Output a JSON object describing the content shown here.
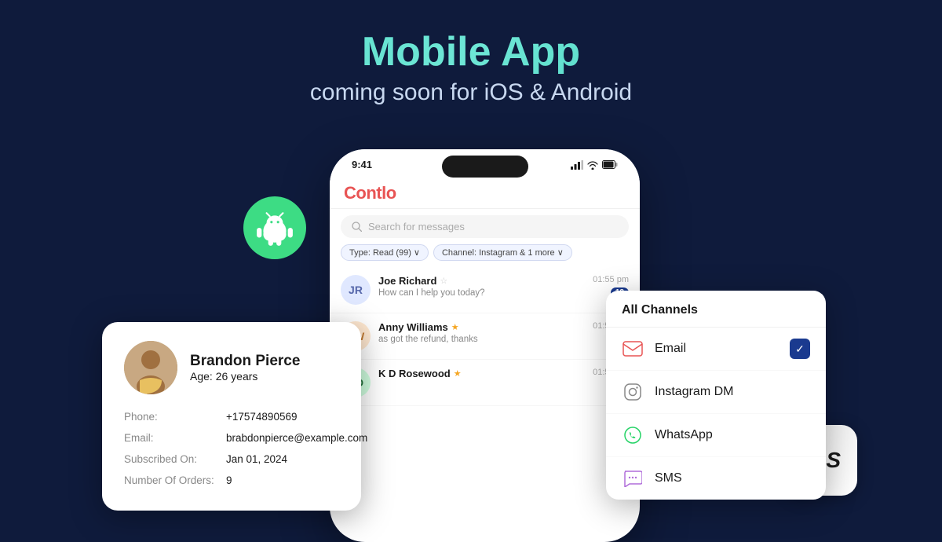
{
  "header": {
    "title": "Mobile App",
    "subtitle": "coming soon for iOS & Android"
  },
  "phone": {
    "time": "9:41",
    "app_name": "Contlo",
    "search_placeholder": "Search for messages",
    "filter_chips": [
      "Type: Read (99) ∨",
      "Channel: Instagram & 1 more ∨"
    ],
    "chats": [
      {
        "name": "Joe Richard",
        "starred": false,
        "preview": "How can I help you today?",
        "time": "01:55 pm",
        "badge": "12",
        "initials": "JR"
      },
      {
        "name": "Anny Williams",
        "starred": true,
        "preview": "as got the refund, thanks",
        "time": "01:55 pm",
        "badge": "",
        "initials": "AW"
      },
      {
        "name": "K D Rosewood",
        "starred": true,
        "preview": "",
        "time": "01:55 pm",
        "badge": "",
        "initials": "KD"
      }
    ]
  },
  "contact_card": {
    "name": "Brandon Pierce",
    "age_label": "Age:",
    "age": "26 years",
    "fields": [
      {
        "label": "Phone:",
        "value": "+17574890569"
      },
      {
        "label": "Email:",
        "value": "brabdonpierce@example.com"
      },
      {
        "label": "Subscribed On:",
        "value": "Jan 01, 2024"
      },
      {
        "label": "Number Of Orders:",
        "value": "9"
      }
    ]
  },
  "dropdown": {
    "header": "All Channels",
    "items": [
      {
        "icon": "email",
        "label": "Email",
        "checked": true
      },
      {
        "icon": "instagram",
        "label": "Instagram DM",
        "checked": false
      },
      {
        "icon": "whatsapp",
        "label": "WhatsApp",
        "checked": false
      },
      {
        "icon": "sms",
        "label": "SMS",
        "checked": false
      }
    ]
  },
  "ios_badge": "iOS",
  "colors": {
    "bg": "#0f1b3c",
    "accent_teal": "#4fd8c4",
    "android_green": "#3ddc84",
    "app_red": "#e85454",
    "check_blue": "#1a3a8f"
  }
}
